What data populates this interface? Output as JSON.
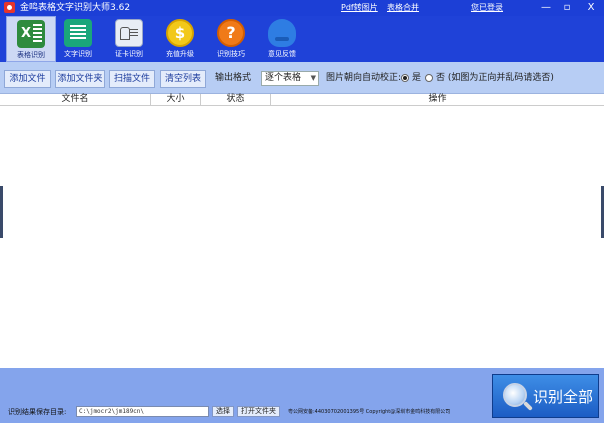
{
  "window": {
    "title": "金鸣表格文字识别大师3.62",
    "links": {
      "pdf_convert": "Pdf转图片",
      "table_merge": "表格合并",
      "login": "您已登录"
    },
    "controls": {
      "minimize": "—",
      "restore": "▫",
      "close": "X"
    }
  },
  "toolbar": {
    "items": [
      {
        "label": "表格识别",
        "icon": "excel-icon",
        "active": true
      },
      {
        "label": "文字识别",
        "icon": "text-doc-icon",
        "active": false
      },
      {
        "label": "证卡识别",
        "icon": "id-card-icon",
        "active": false
      },
      {
        "label": "充值升级",
        "icon": "coin-icon",
        "active": false
      },
      {
        "label": "识别技巧",
        "icon": "question-icon",
        "active": false
      },
      {
        "label": "意见反馈",
        "icon": "feedback-icon",
        "active": false
      }
    ]
  },
  "actions": {
    "add_file": "添加文件",
    "add_folder": "添加文件夹",
    "scan_file": "扫描文件",
    "clear_list": "清空列表",
    "output_format_label": "输出格式",
    "output_format_value": "逐个表格",
    "auto_correct_label": "图片朝向自动校正:",
    "yes_label": "是",
    "no_label": "否 (如图为正向并乱码请选否)",
    "auto_correct_selected": "是"
  },
  "table": {
    "columns": [
      "文件名",
      "大小",
      "状态",
      "操作"
    ],
    "rows": []
  },
  "bottom": {
    "save_dir_label": "识别结果保存目录:",
    "save_dir_value": "C:\\jmocr2\\jm189cn\\",
    "choose": "选择",
    "open_folder": "打开文件夹",
    "footer": "粤公网安备:44030702001395号 Copyright@深圳市金鸣科技有限公司",
    "recognize_all": "识别全部"
  },
  "colors": {
    "title_bar": "#1c3fd6",
    "toolbar": "#1f42d8",
    "action_bar": "#b7cdf4",
    "bottom_bar": "#84a4ec",
    "primary_button": "#1c5cc4"
  }
}
